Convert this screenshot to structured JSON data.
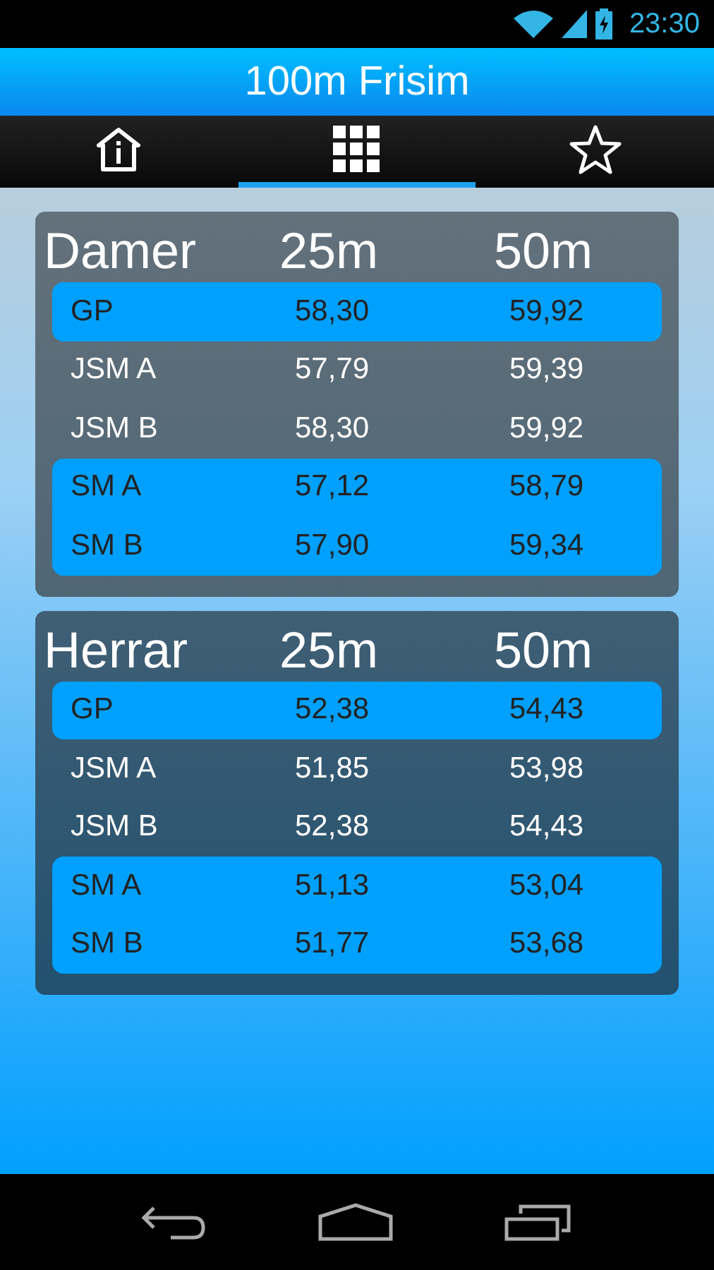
{
  "status_bar": {
    "time": "23:30"
  },
  "title": "100m Frisim",
  "tabs": [
    {
      "kind": "info",
      "selected": false
    },
    {
      "kind": "grid",
      "selected": true
    },
    {
      "kind": "star",
      "selected": false
    }
  ],
  "tables": [
    {
      "title": "Damer",
      "columns": [
        "25m",
        "50m"
      ],
      "groups": [
        {
          "highlighted": true,
          "rows": [
            {
              "label": "GP",
              "values": [
                "58,30",
                "59,92"
              ]
            }
          ]
        },
        {
          "highlighted": false,
          "rows": [
            {
              "label": "JSM A",
              "values": [
                "57,79",
                "59,39"
              ]
            },
            {
              "label": "JSM B",
              "values": [
                "58,30",
                "59,92"
              ]
            }
          ]
        },
        {
          "highlighted": true,
          "rows": [
            {
              "label": "SM A",
              "values": [
                "57,12",
                "58,79"
              ]
            },
            {
              "label": "SM B",
              "values": [
                "57,90",
                "59,34"
              ]
            }
          ]
        }
      ]
    },
    {
      "title": "Herrar",
      "columns": [
        "25m",
        "50m"
      ],
      "groups": [
        {
          "highlighted": true,
          "rows": [
            {
              "label": "GP",
              "values": [
                "52,38",
                "54,43"
              ]
            }
          ]
        },
        {
          "highlighted": false,
          "rows": [
            {
              "label": "JSM A",
              "values": [
                "51,85",
                "53,98"
              ]
            },
            {
              "label": "JSM B",
              "values": [
                "52,38",
                "54,43"
              ]
            }
          ]
        },
        {
          "highlighted": true,
          "rows": [
            {
              "label": "SM A",
              "values": [
                "51,13",
                "53,04"
              ]
            },
            {
              "label": "SM B",
              "values": [
                "51,77",
                "53,68"
              ]
            }
          ]
        }
      ]
    }
  ]
}
